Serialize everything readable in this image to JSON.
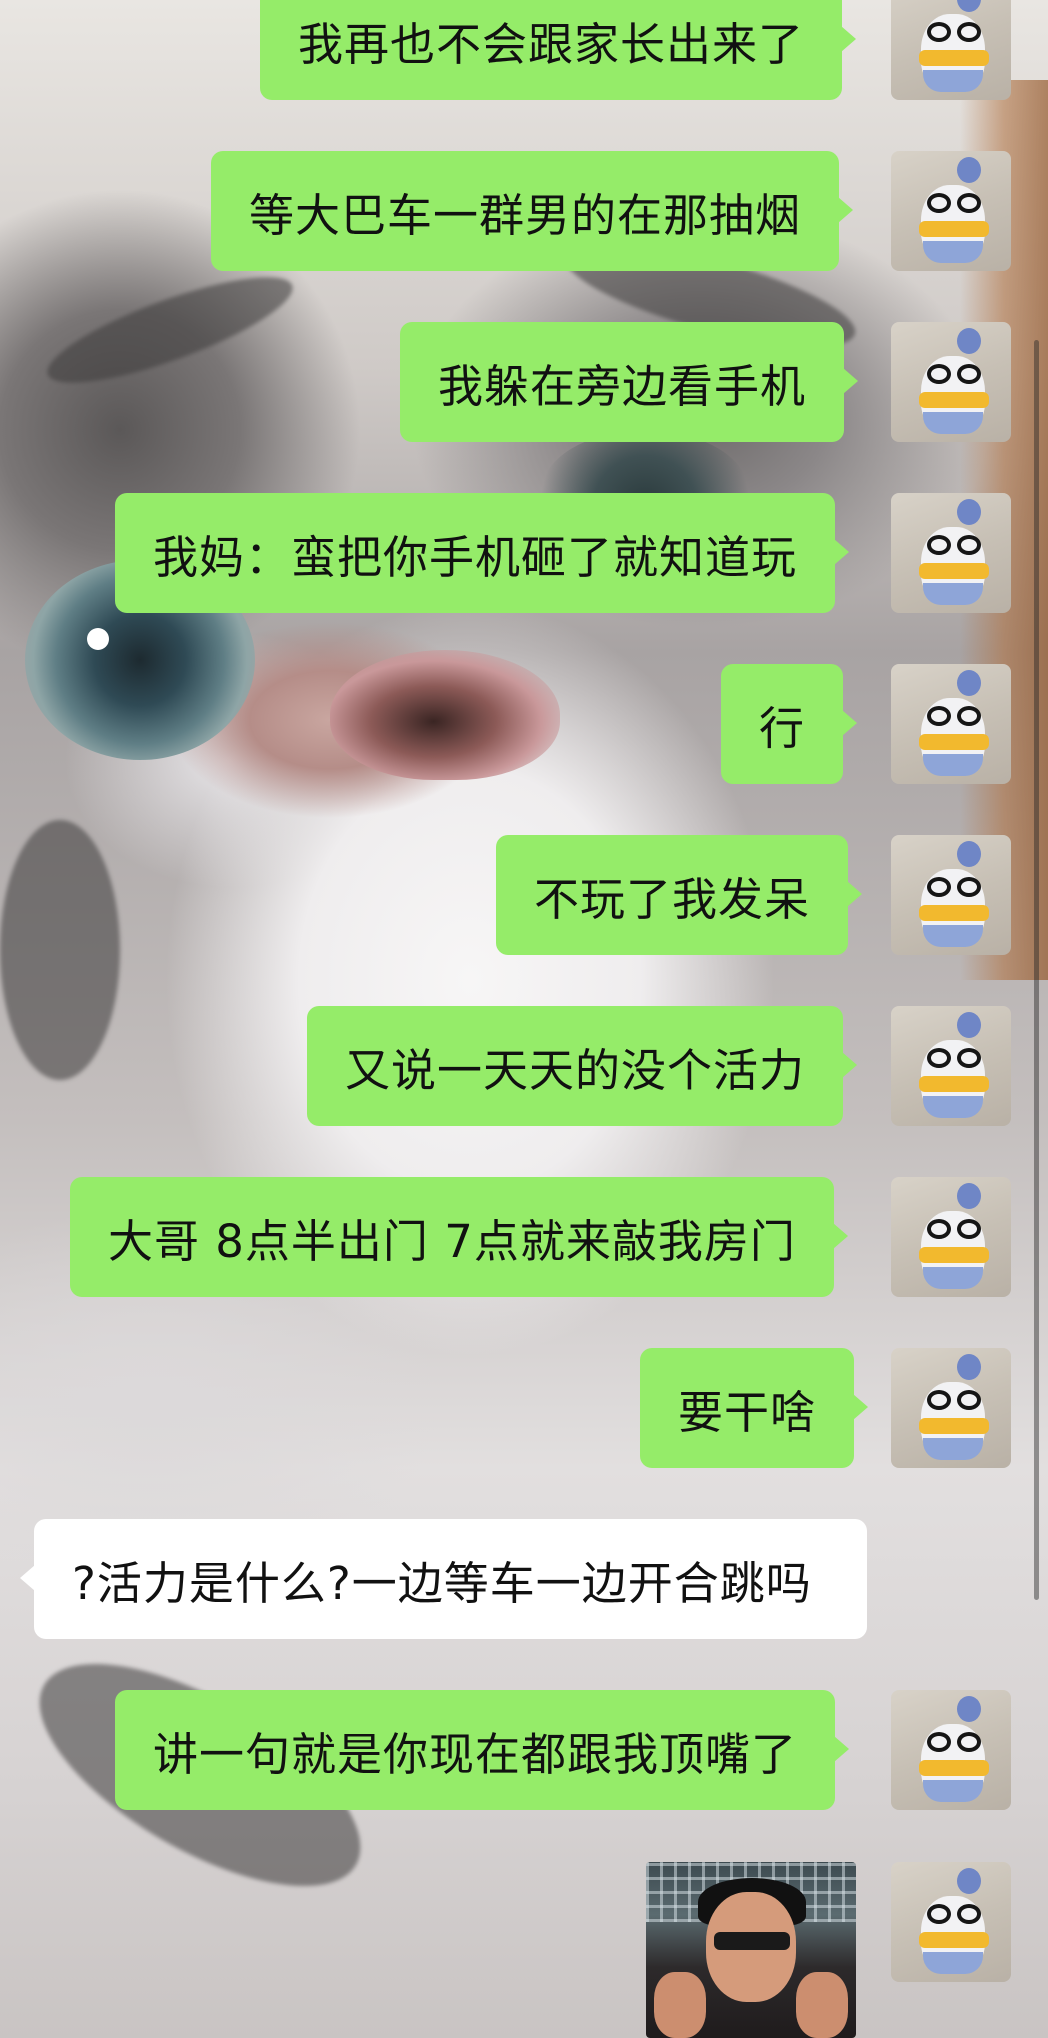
{
  "background": {
    "description_icon": "cat-photo-background"
  },
  "colors": {
    "sent_bubble": "#95ec69",
    "received_bubble": "#ffffff",
    "text": "#111111"
  },
  "messages": [
    {
      "side": "right",
      "text": "我再也不会跟家长出来了"
    },
    {
      "side": "right",
      "text": "等大巴车一群男的在那抽烟"
    },
    {
      "side": "right",
      "text": "我躲在旁边看手机"
    },
    {
      "side": "right",
      "text": "我妈：蛮把你手机砸了就知道玩"
    },
    {
      "side": "right",
      "text": "行"
    },
    {
      "side": "right",
      "text": "不玩了我发呆"
    },
    {
      "side": "right",
      "text": "又说一天天的没个活力"
    },
    {
      "side": "right",
      "text": "大哥 8点半出门 7点就来敲我房门"
    },
    {
      "side": "right",
      "text": "要干啥"
    },
    {
      "side": "left",
      "text": "?活力是什么?一边等车一边开合跳吗"
    },
    {
      "side": "right",
      "text": "讲一句就是你现在都跟我顶嘴了"
    },
    {
      "side": "right",
      "type": "sticker",
      "icon": "meme-sticker-image"
    }
  ],
  "avatar": {
    "icon": "penguin-plush-avatar"
  }
}
